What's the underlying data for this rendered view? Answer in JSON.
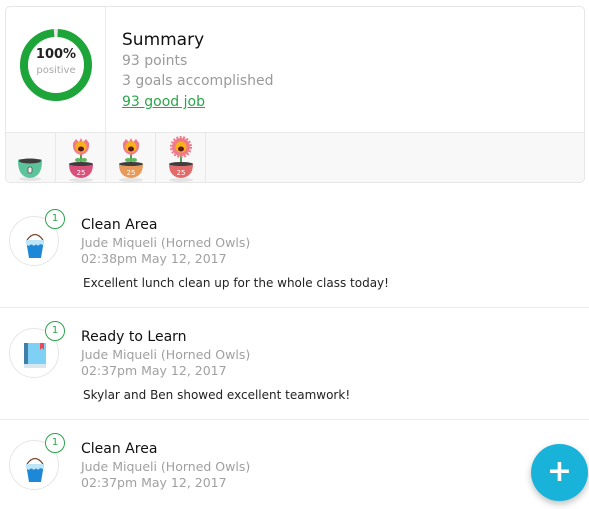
{
  "summary": {
    "ring_percent": "100%",
    "ring_label": "positive",
    "ring_fraction": 1.0,
    "ring_color": "#1ea53a",
    "title": "Summary",
    "points": "93 points",
    "goals": "3 goals accomplished",
    "good_job_link": "93 good job"
  },
  "pots": [
    {
      "type": "empty-pot",
      "label": "",
      "color": "#5cc49a"
    },
    {
      "type": "flower-pot",
      "label": "25",
      "color": "#d9507a"
    },
    {
      "type": "flower-pot",
      "label": "25",
      "color": "#e79a5a"
    },
    {
      "type": "daisy-pot",
      "label": "25",
      "color": "#e26a6a"
    }
  ],
  "feed": [
    {
      "icon": "bucket-icon",
      "count": "1",
      "title": "Clean Area",
      "author": "Jude Miqueli (Horned Owls)",
      "timestamp": "02:38pm May 12, 2017",
      "note": "Excellent lunch clean up for the whole class today!"
    },
    {
      "icon": "book-icon",
      "count": "1",
      "title": "Ready to Learn",
      "author": "Jude Miqueli (Horned Owls)",
      "timestamp": "02:37pm May 12, 2017",
      "note": "Skylar and Ben showed excellent teamwork!"
    },
    {
      "icon": "bucket-icon",
      "count": "1",
      "title": "Clean Area",
      "author": "Jude Miqueli (Horned Owls)",
      "timestamp": "02:37pm May 12, 2017",
      "note": ""
    }
  ],
  "fab": {
    "label": "+",
    "color": "#19b3da",
    "icon": "plus-icon"
  }
}
